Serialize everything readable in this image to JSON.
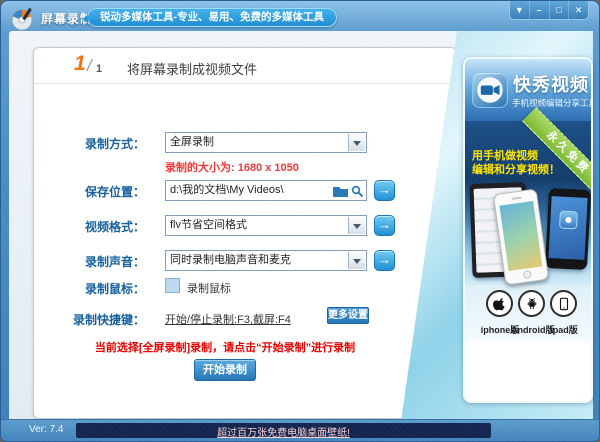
{
  "window": {
    "title": "屏幕录制",
    "banner_bubble": "锐动多媒体工具-专业、易用、免费的多媒体工具",
    "controls": {
      "menu": "▼",
      "minimize": "–",
      "maximize": "□",
      "close": "✕"
    },
    "statusbar": {
      "version": "Ver: 7.4",
      "promo_link": "超过百万张免费电脑桌面壁纸!"
    }
  },
  "main": {
    "step": {
      "number": "1",
      "separator": "/",
      "total": "1"
    },
    "heading": "将屏幕录制成视频文件",
    "form": {
      "record_mode": {
        "label": "录制方式：",
        "value": "全屏录制"
      },
      "size_note": "录制的大小为: 1680 x 1050",
      "save_path": {
        "label": "保存位置：",
        "value": "d:\\我的文档\\My Videos\\"
      },
      "video_format": {
        "label": "视频格式：",
        "value": "flv节省空间格式"
      },
      "record_sound": {
        "label": "录制声音：",
        "value": "同时录制电脑声音和麦克"
      },
      "record_mouse": {
        "label": "录制鼠标：",
        "checkbox_label": "录制鼠标",
        "checked": false
      },
      "hotkeys": {
        "label": "录制快捷键：",
        "value": "开始/停止录制:F3,截屏:F4",
        "more_button": "更多设置"
      }
    },
    "notice": "当前选择[全屏录制]录制，请点击“开始录制”进行录制",
    "start_button": "开始录制"
  },
  "sidebar": {
    "app_name": "快秀视频",
    "tagline": "手机视频编辑分享工具",
    "ribbon": "永久免费",
    "promo_line1": "用手机做视频",
    "promo_line2": "编辑和分享视频！",
    "platforms": [
      {
        "label": "iphone版"
      },
      {
        "label": "Android版"
      },
      {
        "label": "ipad版"
      }
    ]
  },
  "icons": {
    "go_arrow": "→"
  },
  "colors": {
    "label_blue": "#15609f",
    "alert_red": "#e60000",
    "button_blue": "#2f86c8",
    "ribbon_green": "#8cc63e",
    "promo_yellow": "#ffe400",
    "footer_navy": "#142650"
  }
}
